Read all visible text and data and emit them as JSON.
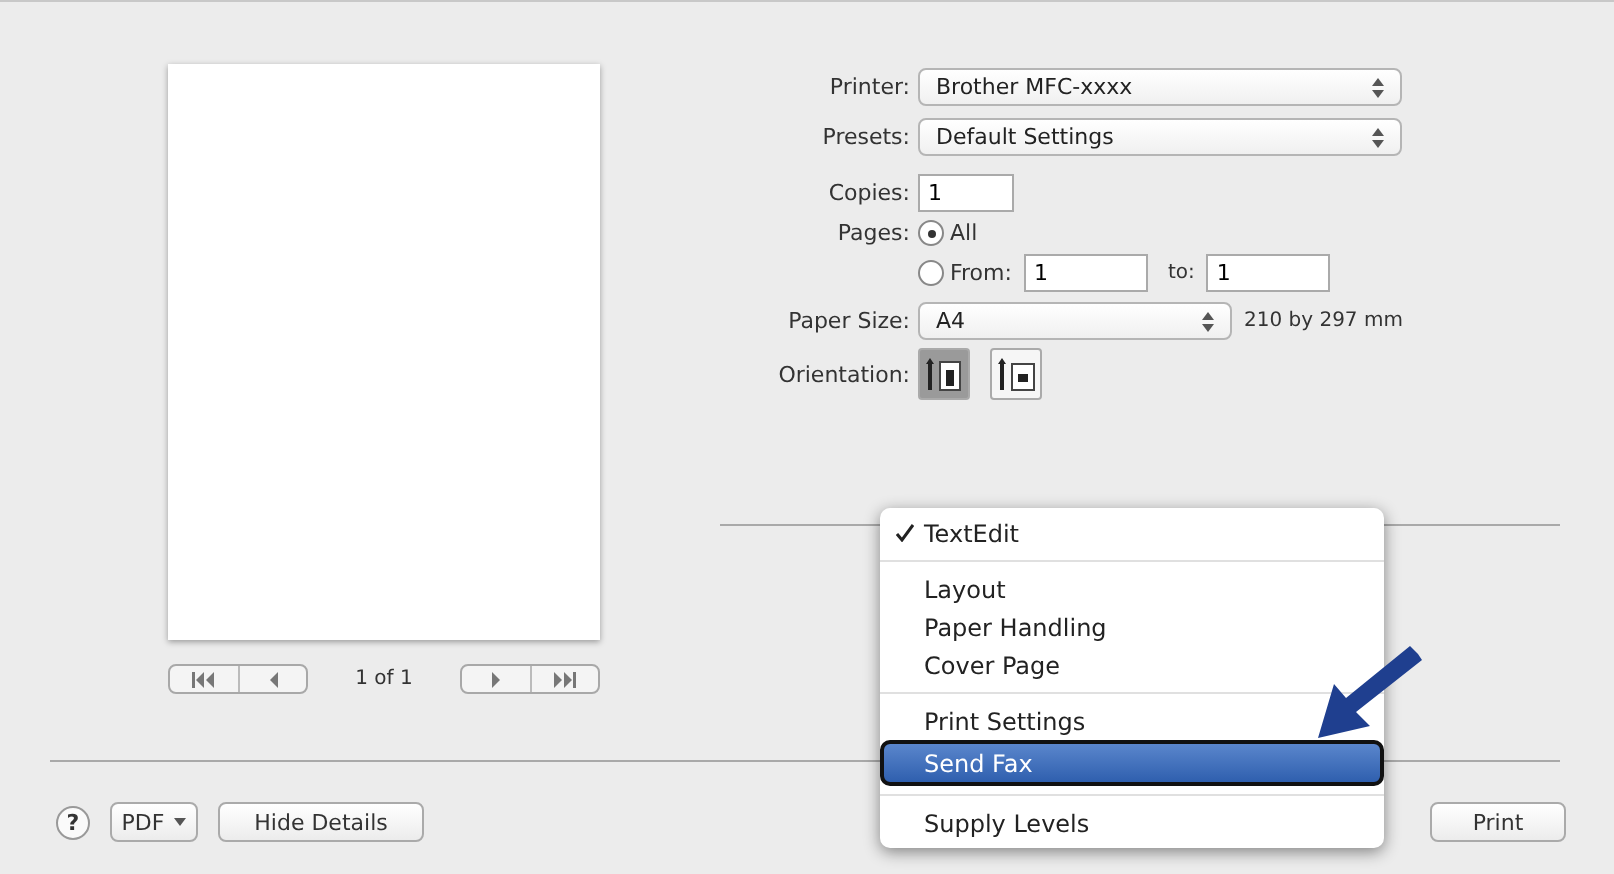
{
  "printer": {
    "label": "Printer:",
    "value": "Brother MFC-xxxx"
  },
  "presets": {
    "label": "Presets:",
    "value": "Default Settings"
  },
  "copies": {
    "label": "Copies:",
    "value": "1"
  },
  "pages": {
    "label": "Pages:",
    "options": [
      {
        "label": "All",
        "selected": true
      },
      {
        "label": "From:",
        "selected": false
      }
    ],
    "from": "1",
    "to_label": "to:",
    "to": "1"
  },
  "paper_size": {
    "label": "Paper Size:",
    "value": "A4",
    "dimensions": "210 by 297 mm"
  },
  "orientation": {
    "label": "Orientation:",
    "options": [
      {
        "kind": "portrait",
        "selected": true
      },
      {
        "kind": "landscape",
        "selected": false
      }
    ]
  },
  "preview": {
    "page_count": "1 of 1"
  },
  "menu": {
    "sections": [
      [
        {
          "label": "TextEdit",
          "checked": true,
          "selected": false
        }
      ],
      [
        {
          "label": "Layout",
          "checked": false,
          "selected": false
        },
        {
          "label": "Paper Handling",
          "checked": false,
          "selected": false
        },
        {
          "label": "Cover Page",
          "checked": false,
          "selected": false
        }
      ],
      [
        {
          "label": "Print Settings",
          "checked": false,
          "selected": false
        },
        {
          "label": "Send Fax",
          "checked": false,
          "selected": true
        }
      ],
      [
        {
          "label": "Supply Levels",
          "checked": false,
          "selected": false
        }
      ]
    ]
  },
  "bottom_bar": {
    "help": "?",
    "pdf": "PDF",
    "hide_details": "Hide Details",
    "print": "Print"
  }
}
